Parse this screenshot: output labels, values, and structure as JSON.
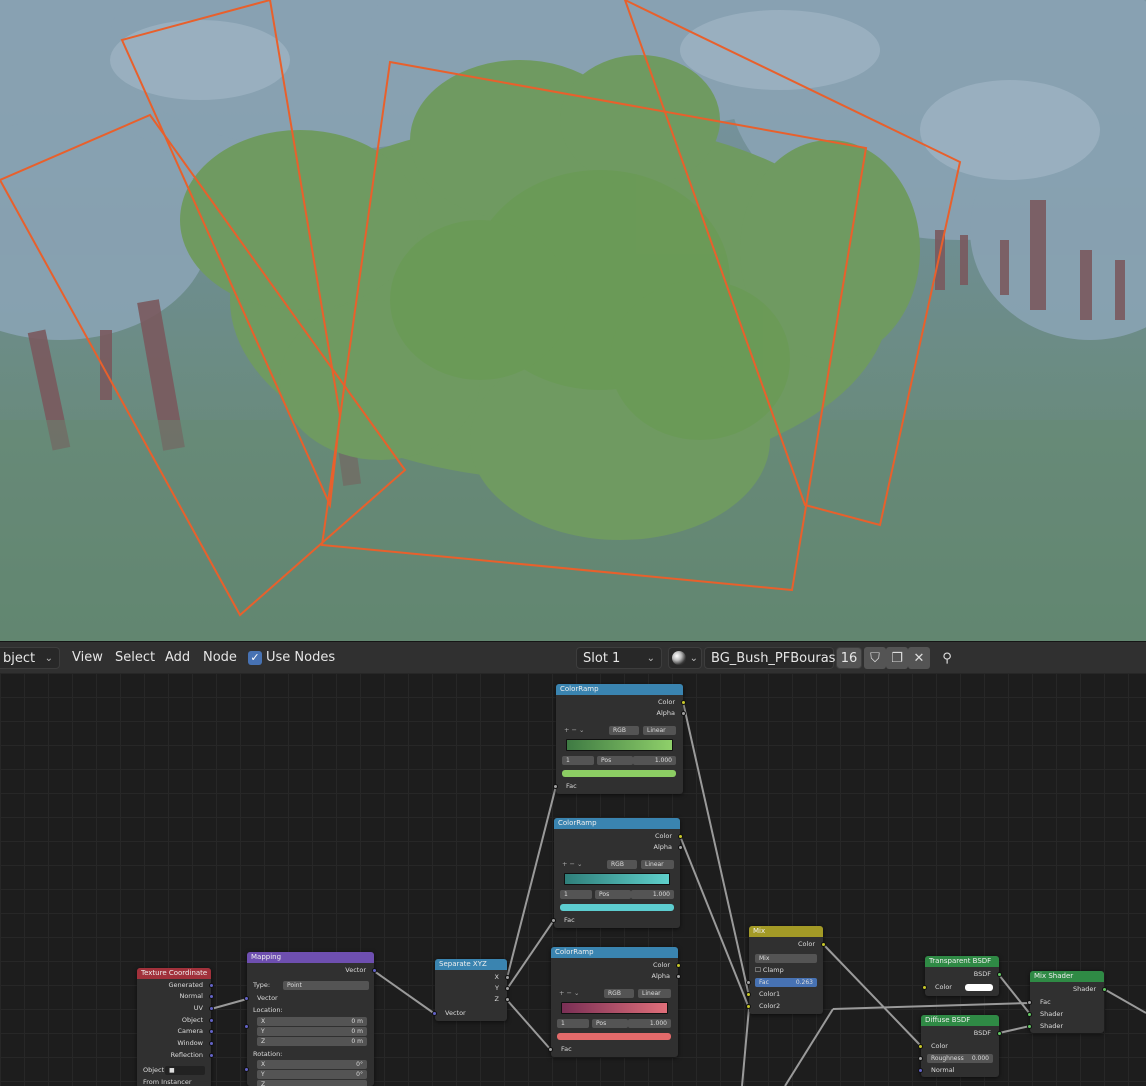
{
  "header": {
    "mode_label": "bject",
    "menu_view": "View",
    "menu_select": "Select",
    "menu_add": "Add",
    "menu_node": "Node",
    "use_nodes_label": "Use Nodes",
    "use_nodes_checked": true,
    "slot_label": "Slot 1",
    "material_name": "BG_Bush_PFBouras...",
    "user_count": "16"
  },
  "colors": {
    "header_bg": "#303030",
    "selection_outline": "#e8602c",
    "bush_green": "#6f9a61",
    "input_node": "#a1313b",
    "vector_node": "#6e4fb0",
    "converter_node": "#3a84b0",
    "color_node": "#a39a26",
    "shader_node": "#2f8a45"
  },
  "nodes": {
    "ramp1": {
      "title": "ColorRamp",
      "out_color": "Color",
      "out_alpha": "Alpha",
      "mode": "RGB",
      "interp": "Linear",
      "index": "1",
      "pos_label": "Pos",
      "pos_value": "1.000",
      "in_fac": "Fac"
    },
    "ramp2": {
      "title": "ColorRamp",
      "out_color": "Color",
      "out_alpha": "Alpha",
      "mode": "RGB",
      "interp": "Linear",
      "index": "1",
      "pos_label": "Pos",
      "pos_value": "1.000",
      "in_fac": "Fac"
    },
    "ramp3": {
      "title": "ColorRamp",
      "out_color": "Color",
      "out_alpha": "Alpha",
      "mode": "RGB",
      "interp": "Linear",
      "index": "1",
      "pos_label": "Pos",
      "pos_value": "1.000",
      "in_fac": "Fac"
    },
    "texcoord": {
      "title": "Texture Coordinate",
      "outputs": [
        "Generated",
        "Normal",
        "UV",
        "Object",
        "Camera",
        "Window",
        "Reflection"
      ],
      "object_label": "Object",
      "from_instancer": "From Instancer"
    },
    "mapping": {
      "title": "Mapping",
      "out_vector": "Vector",
      "type_label": "Type:",
      "type_value": "Point",
      "in_vector": "Vector",
      "location_label": "Location:",
      "loc_x": "X",
      "loc_y": "Y",
      "loc_z": "Z",
      "loc_x_val": "0 m",
      "loc_y_val": "0 m",
      "loc_z_val": "0 m",
      "rotation_label": "Rotation:",
      "rot_x": "X",
      "rot_y": "Y",
      "rot_z": "Z",
      "rot_x_val": "0°",
      "rot_y_val": "0°"
    },
    "separate": {
      "title": "Separate XYZ",
      "out_x": "X",
      "out_y": "Y",
      "out_z": "Z",
      "in_vector": "Vector"
    },
    "mix": {
      "title": "Mix",
      "out_color": "Color",
      "blend": "Mix",
      "clamp": "Clamp",
      "fac_label": "Fac",
      "fac_value": "0.263",
      "color1": "Color1",
      "color2": "Color2"
    },
    "transparent": {
      "title": "Transparent BSDF",
      "out_bsdf": "BSDF",
      "in_color": "Color"
    },
    "diffuse": {
      "title": "Diffuse BSDF",
      "out_bsdf": "BSDF",
      "in_color": "Color",
      "roughness_label": "Roughness",
      "roughness_value": "0.000",
      "in_normal": "Normal"
    },
    "mixshader": {
      "title": "Mix Shader",
      "out_shader": "Shader",
      "in_fac": "Fac",
      "in_shader1": "Shader",
      "in_shader2": "Shader"
    }
  }
}
